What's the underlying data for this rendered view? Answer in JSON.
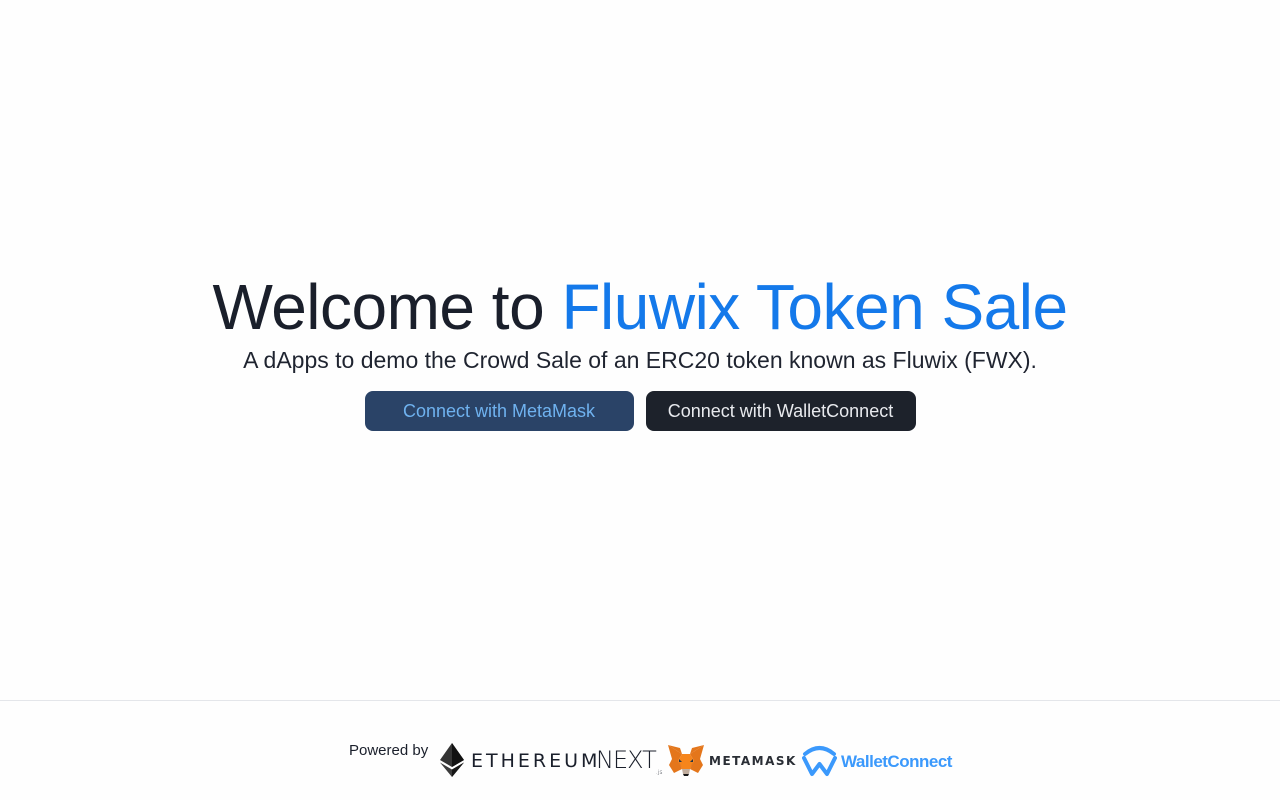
{
  "hero": {
    "title_prefix": "Welcome to ",
    "title_accent": "Fluwix Token Sale",
    "subtitle": "A dApps to demo the Crowd Sale of an ERC20 token known as Fluwix (FWX)."
  },
  "buttons": {
    "metamask_label": "Connect with MetaMask",
    "walletconnect_label": "Connect with WalletConnect"
  },
  "footer": {
    "powered_by": "Powered by",
    "logos": {
      "ethereum_text": "ETHEREUM",
      "next_text": "NEXT",
      "next_suffix": ".js",
      "metamask_text": "METAMASK",
      "walletconnect_text": "WalletConnect"
    }
  },
  "colors": {
    "accent": "#1479ea",
    "metamask_button_bg": "#2a4367",
    "metamask_button_text": "#6fb2ef",
    "walletconnect_button_bg": "#1d222b",
    "walletconnect_brand": "#3b99fc"
  },
  "icons": {
    "ethereum": "ethereum-diamond-icon",
    "metamask": "metamask-fox-icon",
    "walletconnect": "walletconnect-wave-icon"
  }
}
